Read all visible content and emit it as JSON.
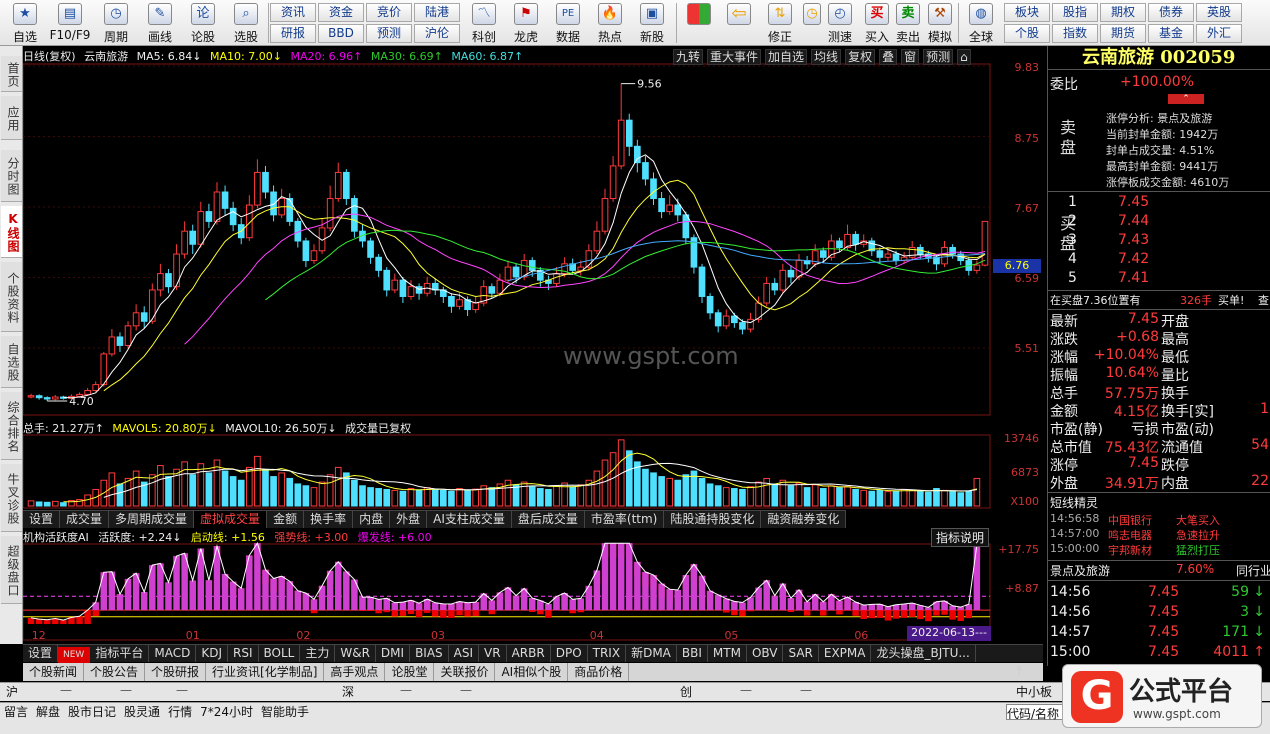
{
  "toolbar": {
    "left": [
      {
        "label": "自选",
        "icon": "star-icon"
      },
      {
        "label": "F10/F9",
        "icon": "f10-icon"
      },
      {
        "label": "周期",
        "icon": "clock-icon"
      },
      {
        "label": "画线",
        "icon": "pencil-icon"
      },
      {
        "label": "论股",
        "icon": "chat-icon"
      },
      {
        "label": "选股",
        "icon": "magnifier-icon"
      }
    ],
    "mid_top": [
      "资讯",
      "资金",
      "竞价",
      "陆港"
    ],
    "mid_bottom": [
      "研报",
      "BBD",
      "预测",
      "沪伦"
    ],
    "mid_icons": [
      {
        "label": "科创",
        "icon": "chart-icon"
      },
      {
        "label": "龙虎",
        "icon": "tiger-icon"
      },
      {
        "label": "数据",
        "icon": "pe-icon"
      },
      {
        "label": "热点",
        "icon": "hot-icon"
      },
      {
        "label": "新股",
        "icon": "newstock-icon"
      }
    ],
    "right_icons": [
      {
        "label": "",
        "icon": "grid-icon"
      },
      {
        "label": "",
        "icon": "back-arrow-icon"
      },
      {
        "label": "修正",
        "icon": "up-down-icon"
      },
      {
        "label": "测速",
        "icon": "speed-icon"
      },
      {
        "label": "买入",
        "icon": "buy-icon",
        "glyph": "买"
      },
      {
        "label": "卖出",
        "icon": "sell-icon",
        "glyph": "卖"
      },
      {
        "label": "模拟",
        "icon": "hammer-icon"
      },
      {
        "label": "全球",
        "icon": "globe-icon"
      }
    ],
    "far_top": [
      "板块",
      "股指",
      "期权",
      "债券",
      "英股"
    ],
    "far_bottom": [
      "个股",
      "指数",
      "期货",
      "基金",
      "外汇"
    ]
  },
  "leftnav": [
    "首页",
    "应用",
    "分时图",
    "K线图",
    "个股资料",
    "自选股",
    "综合排名",
    "牛叉诊股",
    "超级盘口"
  ],
  "chart_header": {
    "mode": "日线(复权)",
    "stock": "云南旅游",
    "ma5": "MA5: 6.84↓",
    "ma10": "MA10: 7.00↓",
    "ma20": "MA20: 6.96↑",
    "ma30": "MA30: 6.69↑",
    "ma60": "MA60: 6.87↑"
  },
  "chart_buttons": [
    "九转",
    "重大事件",
    "加自选",
    "均线",
    "复权",
    "叠",
    "窗",
    "预测",
    "⌂"
  ],
  "price_axis": [
    "9.83",
    "8.75",
    "7.67",
    "6.59",
    "5.51"
  ],
  "price_annotations": {
    "high": "9.56",
    "low": "4.70",
    "current_tag": "6.76"
  },
  "volume_header": {
    "total": "总手: 21.27万↑",
    "mavol5": "MAVOL5: 20.80万↓",
    "mavol10": "MAVOL10: 26.50万↓",
    "note": "成交量已复权"
  },
  "volume_axis": [
    "13746",
    "6873",
    "X100"
  ],
  "tabs": [
    {
      "label": "设置",
      "sel": false
    },
    {
      "label": "成交量",
      "sel": false
    },
    {
      "label": "多周期成交量",
      "sel": false
    },
    {
      "label": "虚拟成交量",
      "sel": true
    },
    {
      "label": "金额",
      "sel": false
    },
    {
      "label": "换手率",
      "sel": false
    },
    {
      "label": "内盘",
      "sel": false
    },
    {
      "label": "外盘",
      "sel": false
    },
    {
      "label": "AI支柱成交量",
      "sel": false
    },
    {
      "label": "盘后成交量",
      "sel": false
    },
    {
      "label": "市盈率(ttm)",
      "sel": false
    },
    {
      "label": "陆股通持股变化",
      "sel": false
    },
    {
      "label": "融资融券变化",
      "sel": false
    }
  ],
  "indicator_header": {
    "name": "机构活跃度AI",
    "active": "活跃度: +2.24↓",
    "start": "启动线: +1.56",
    "strong": "强势线: +3.00",
    "burst": "爆发线: +6.00",
    "help": "指标说明"
  },
  "indicator_axis": [
    "+17.75",
    "+8.87"
  ],
  "x_axis": [
    "12",
    "01",
    "02",
    "03",
    "04",
    "05",
    "06"
  ],
  "x_date": "2022-06-13---",
  "chart_data": {
    "type": "candlestick",
    "highs_label": "9.56",
    "low_label": "4.70",
    "ylim": [
      4.5,
      9.83
    ],
    "candles": [
      [
        4.76,
        4.78,
        4.81,
        4.74
      ],
      [
        4.78,
        4.75,
        4.8,
        4.72
      ],
      [
        4.75,
        4.73,
        4.77,
        4.7
      ],
      [
        4.73,
        4.76,
        4.79,
        4.71
      ],
      [
        4.76,
        4.74,
        4.78,
        4.72
      ],
      [
        4.74,
        4.77,
        4.8,
        4.73
      ],
      [
        4.77,
        4.8,
        4.83,
        4.75
      ],
      [
        4.8,
        4.86,
        4.9,
        4.78
      ],
      [
        4.86,
        4.95,
        5.0,
        4.84
      ],
      [
        4.95,
        5.42,
        5.45,
        4.92
      ],
      [
        5.42,
        5.68,
        5.8,
        5.38
      ],
      [
        5.68,
        5.55,
        5.75,
        5.45
      ],
      [
        5.55,
        5.85,
        5.92,
        5.5
      ],
      [
        5.85,
        6.05,
        6.18,
        5.78
      ],
      [
        6.05,
        5.92,
        6.15,
        5.82
      ],
      [
        5.92,
        6.4,
        6.5,
        5.88
      ],
      [
        6.4,
        6.65,
        6.8,
        6.3
      ],
      [
        6.65,
        6.45,
        6.72,
        6.35
      ],
      [
        6.45,
        6.95,
        7.1,
        6.4
      ],
      [
        6.95,
        7.3,
        7.45,
        6.88
      ],
      [
        7.3,
        7.1,
        7.4,
        6.95
      ],
      [
        7.1,
        7.6,
        7.75,
        7.05
      ],
      [
        7.6,
        7.45,
        7.72,
        7.35
      ],
      [
        7.45,
        7.9,
        8.05,
        7.4
      ],
      [
        7.9,
        7.65,
        8.0,
        7.55
      ],
      [
        7.65,
        7.4,
        7.75,
        7.3
      ],
      [
        7.4,
        7.2,
        7.5,
        7.1
      ],
      [
        7.2,
        7.7,
        7.85,
        7.15
      ],
      [
        7.7,
        8.2,
        8.4,
        7.65
      ],
      [
        8.2,
        7.9,
        8.3,
        7.8
      ],
      [
        7.9,
        7.55,
        8.0,
        7.45
      ],
      [
        7.55,
        7.8,
        7.95,
        7.5
      ],
      [
        7.8,
        7.45,
        7.88,
        7.38
      ],
      [
        7.45,
        7.15,
        7.5,
        7.05
      ],
      [
        7.15,
        6.85,
        7.2,
        6.75
      ],
      [
        6.85,
        7.0,
        7.1,
        6.8
      ],
      [
        7.0,
        7.35,
        7.5,
        6.95
      ],
      [
        7.35,
        7.8,
        8.0,
        7.3
      ],
      [
        7.8,
        8.2,
        8.35,
        7.75
      ],
      [
        8.2,
        7.8,
        8.25,
        7.7
      ],
      [
        7.8,
        7.3,
        7.85,
        7.2
      ],
      [
        7.3,
        7.15,
        7.4,
        7.05
      ],
      [
        7.15,
        6.9,
        7.2,
        6.8
      ],
      [
        6.9,
        6.7,
        6.95,
        6.6
      ],
      [
        6.7,
        6.4,
        6.75,
        6.3
      ],
      [
        6.4,
        6.55,
        6.65,
        6.35
      ],
      [
        6.55,
        6.3,
        6.6,
        6.2
      ],
      [
        6.3,
        6.45,
        6.55,
        6.25
      ],
      [
        6.45,
        6.35,
        6.5,
        6.25
      ],
      [
        6.35,
        6.5,
        6.6,
        6.3
      ],
      [
        6.5,
        6.4,
        6.58,
        6.32
      ],
      [
        6.4,
        6.3,
        6.45,
        6.2
      ],
      [
        6.3,
        6.15,
        6.35,
        6.05
      ],
      [
        6.15,
        6.25,
        6.35,
        6.1
      ],
      [
        6.25,
        6.1,
        6.3,
        6.0
      ],
      [
        6.1,
        6.2,
        6.3,
        6.05
      ],
      [
        6.2,
        6.45,
        6.55,
        6.15
      ],
      [
        6.45,
        6.35,
        6.5,
        6.28
      ],
      [
        6.35,
        6.55,
        6.65,
        6.3
      ],
      [
        6.55,
        6.75,
        6.85,
        6.5
      ],
      [
        6.75,
        6.6,
        6.8,
        6.5
      ],
      [
        6.6,
        6.85,
        6.95,
        6.55
      ],
      [
        6.85,
        6.7,
        6.9,
        6.6
      ],
      [
        6.7,
        6.55,
        6.75,
        6.45
      ],
      [
        6.55,
        6.5,
        6.62,
        6.4
      ],
      [
        6.5,
        6.65,
        6.75,
        6.45
      ],
      [
        6.65,
        6.8,
        6.9,
        6.6
      ],
      [
        6.8,
        6.7,
        6.88,
        6.65
      ],
      [
        6.7,
        6.75,
        6.85,
        6.62
      ],
      [
        6.75,
        7.0,
        7.1,
        6.7
      ],
      [
        7.0,
        7.3,
        7.45,
        6.95
      ],
      [
        7.3,
        7.8,
        7.95,
        7.25
      ],
      [
        7.8,
        8.3,
        8.45,
        7.75
      ],
      [
        8.3,
        9.0,
        9.56,
        8.25
      ],
      [
        9.0,
        8.6,
        9.1,
        8.45
      ],
      [
        8.6,
        8.35,
        8.7,
        8.2
      ],
      [
        8.35,
        8.1,
        8.45,
        8.0
      ],
      [
        8.1,
        7.8,
        8.2,
        7.7
      ],
      [
        7.8,
        7.6,
        7.9,
        7.5
      ],
      [
        7.6,
        7.7,
        7.85,
        7.55
      ],
      [
        7.7,
        7.55,
        7.8,
        7.45
      ],
      [
        7.55,
        7.2,
        7.6,
        7.1
      ],
      [
        7.2,
        6.75,
        7.25,
        6.65
      ],
      [
        6.75,
        6.3,
        6.8,
        6.2
      ],
      [
        6.3,
        6.05,
        6.35,
        5.95
      ],
      [
        6.05,
        5.85,
        6.1,
        5.75
      ],
      [
        5.85,
        6.0,
        6.1,
        5.8
      ],
      [
        6.0,
        5.9,
        6.05,
        5.82
      ],
      [
        5.9,
        5.8,
        5.95,
        5.72
      ],
      [
        5.8,
        5.95,
        6.05,
        5.75
      ],
      [
        5.95,
        6.2,
        6.3,
        5.9
      ],
      [
        6.2,
        6.5,
        6.6,
        6.15
      ],
      [
        6.5,
        6.4,
        6.58,
        6.32
      ],
      [
        6.4,
        6.7,
        6.8,
        6.35
      ],
      [
        6.7,
        6.6,
        6.78,
        6.5
      ],
      [
        6.6,
        6.85,
        6.95,
        6.55
      ],
      [
        6.85,
        6.8,
        6.92,
        6.72
      ],
      [
        6.8,
        7.0,
        7.1,
        6.75
      ],
      [
        7.0,
        6.9,
        7.05,
        6.82
      ],
      [
        6.9,
        7.15,
        7.25,
        6.85
      ],
      [
        7.15,
        7.05,
        7.2,
        6.98
      ],
      [
        7.05,
        7.25,
        7.4,
        7.0
      ],
      [
        7.25,
        7.1,
        7.3,
        7.0
      ],
      [
        7.1,
        7.15,
        7.25,
        7.05
      ],
      [
        7.15,
        7.0,
        7.2,
        6.92
      ],
      [
        7.0,
        6.9,
        7.05,
        6.8
      ],
      [
        6.9,
        6.95,
        7.05,
        6.85
      ],
      [
        6.95,
        6.85,
        7.0,
        6.78
      ],
      [
        6.85,
        6.9,
        6.98,
        6.8
      ],
      [
        6.9,
        7.05,
        7.15,
        6.85
      ],
      [
        7.05,
        6.95,
        7.1,
        6.88
      ],
      [
        6.95,
        6.9,
        7.0,
        6.82
      ],
      [
        6.9,
        6.8,
        6.95,
        6.7
      ],
      [
        6.8,
        7.05,
        7.15,
        6.75
      ],
      [
        7.05,
        6.95,
        7.1,
        6.88
      ],
      [
        6.95,
        6.85,
        7.0,
        6.78
      ],
      [
        6.85,
        6.7,
        6.9,
        6.62
      ],
      [
        6.7,
        6.78,
        6.85,
        6.65
      ],
      [
        6.78,
        7.45,
        7.45,
        6.76
      ]
    ],
    "volumes": [
      28,
      22,
      20,
      25,
      18,
      30,
      35,
      60,
      90,
      140,
      180,
      120,
      150,
      190,
      130,
      170,
      220,
      160,
      200,
      240,
      170,
      230,
      180,
      250,
      190,
      160,
      140,
      210,
      270,
      200,
      160,
      180,
      150,
      120,
      110,
      100,
      130,
      170,
      210,
      180,
      140,
      110,
      100,
      95,
      90,
      85,
      80,
      95,
      88,
      100,
      90,
      85,
      80,
      95,
      85,
      92,
      110,
      100,
      120,
      140,
      115,
      130,
      105,
      95,
      90,
      110,
      125,
      105,
      115,
      140,
      190,
      250,
      290,
      360,
      300,
      240,
      200,
      180,
      160,
      150,
      140,
      170,
      190,
      150,
      120,
      110,
      100,
      95,
      90,
      105,
      130,
      150,
      120,
      140,
      110,
      125,
      100,
      115,
      95,
      110,
      100,
      105,
      90,
      85,
      80,
      85,
      78,
      82,
      90,
      85,
      80,
      75,
      95,
      85,
      78,
      72,
      80,
      150
    ]
  },
  "right": {
    "title": "云南旅游 002059",
    "weibi_label": "委比",
    "weibi_val": "+100.00%",
    "zt_lines": [
      "涨停分析: 景点及旅游",
      "当前封单金额: 1942万",
      "封单占成交量: 4.51%",
      "最高封单金额: 9441万",
      "涨停板成交金额: 4610万"
    ],
    "sell_label": "卖盘",
    "buy_label": "买盘",
    "bids": [
      {
        "n": "1",
        "p": "7.45",
        "v": ""
      },
      {
        "n": "2",
        "p": "7.44",
        "v": ""
      },
      {
        "n": "3",
        "p": "7.43",
        "v": ""
      },
      {
        "n": "4",
        "p": "7.42",
        "v": ""
      },
      {
        "n": "5",
        "p": "7.41",
        "v": ""
      }
    ],
    "zaimai": "在买盘7.36位置有",
    "zaimai_v": "326手",
    "zaimai_b": "买单!",
    "zaimai_x": "查",
    "stats": [
      [
        "最新",
        "7.45",
        "开盘",
        ""
      ],
      [
        "涨跌",
        "+0.68",
        "最高",
        ""
      ],
      [
        "涨幅",
        "+10.04%",
        "最低",
        ""
      ],
      [
        "振幅",
        "10.64%",
        "量比",
        ""
      ],
      [
        "总手",
        "57.75万",
        "换手",
        ""
      ],
      [
        "金额",
        "4.15亿",
        "换手[实]",
        "1"
      ],
      [
        "市盈(静)",
        "亏损",
        "市盈(动)",
        ""
      ],
      [
        "总市值",
        "75.43亿",
        "流通值",
        "54"
      ],
      [
        "涨停",
        "7.45",
        "跌停",
        ""
      ],
      [
        "外盘",
        "34.91万",
        "内盘",
        "22"
      ]
    ],
    "dx_title": "短线精灵",
    "dx": [
      [
        "14:56:58",
        "中国银行",
        "大笔买入"
      ],
      [
        "14:57:00",
        "鸣志电器",
        "急速拉升"
      ],
      [
        "15:00:00",
        "宇邦新材",
        "猛烈打压"
      ]
    ],
    "sector_name": "景点及旅游",
    "sector_pct": "7.60%",
    "sector_tail": "同行业",
    "ticks": [
      [
        "14:56",
        "7.45",
        "59"
      ],
      [
        "14:56",
        "7.45",
        "3"
      ],
      [
        "14:57",
        "7.45",
        "171"
      ],
      [
        "15:00",
        "7.45",
        "4011"
      ]
    ]
  },
  "indicators2": [
    "设置",
    "NEW",
    "指标平台",
    "MACD",
    "KDJ",
    "RSI",
    "BOLL",
    "主力",
    "W&R",
    "DMI",
    "BIAS",
    "ASI",
    "VR",
    "ARBR",
    "DPO",
    "TRIX",
    "新DMA",
    "BBI",
    "MTM",
    "OBV",
    "SAR",
    "EXPMA",
    "龙头操盘_BJTU..."
  ],
  "news": [
    "个股新闻",
    "个股公告",
    "个股研报",
    "行业资讯[化学制品]",
    "高手观点",
    "论股堂",
    "关联报价",
    "AI相似个股",
    "商品价格"
  ],
  "status1": {
    "a": "沪",
    "b": "深",
    "c": "创",
    "d": "中小板"
  },
  "status2": [
    "留言",
    "解盘",
    "股市日记",
    "股灵通",
    "行情",
    "7*24小时",
    "智能助手"
  ],
  "status2_right": "代码/名称",
  "watermark": "www.gspt.com",
  "logo": {
    "g": "G",
    "t1": "公式平台",
    "t2": "www.gspt.com"
  }
}
